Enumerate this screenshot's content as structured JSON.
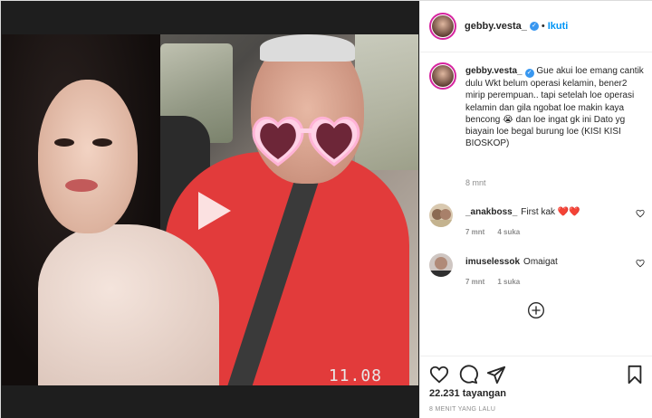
{
  "post": {
    "username": "gebby.vesta_",
    "follow_label": "Ikuti",
    "separator": "•",
    "video_timestamp": "11.08",
    "caption": {
      "username": "gebby.vesta_",
      "text": "Gue akui loe emang cantik dulu Wkt belum operasi kelamin, bener2 mirip perempuan.. tapi setelah loe operasi kelamin dan gila ngobat loe makin kaya bencong 😭 dan loe ingat gk ini Dato yg biayain loe begal burung loe (KISI KISI BIOSKOP)",
      "time": "8 mnt"
    },
    "comments": [
      {
        "username": "_anakboss_",
        "text": "First kak ❤️❤️",
        "time": "7 mnt",
        "likes": "4 suka"
      },
      {
        "username": "imuselessok",
        "text": "Omaigat",
        "time": "7 mnt",
        "likes": "1 suka"
      }
    ],
    "views": "22.231 tayangan",
    "posted_ago": "8 MENIT YANG LALU"
  },
  "colors": {
    "accent": "#0095f6",
    "verified": "#3897f0",
    "heart_red": "#e0245e",
    "muted": "#8e8e8e"
  },
  "icons": [
    "verified-badge-icon",
    "play-icon",
    "heart-icon",
    "comment-icon",
    "share-icon",
    "bookmark-icon",
    "load-more-icon"
  ]
}
